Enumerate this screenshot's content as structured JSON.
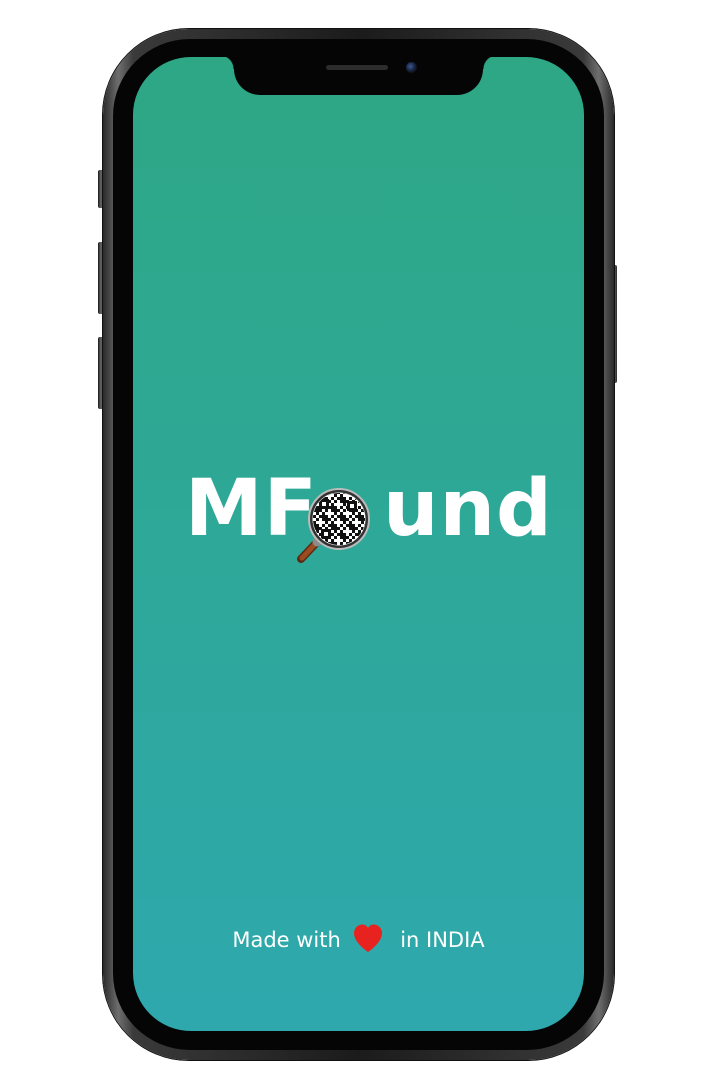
{
  "app": {
    "logo": {
      "text_left": "MF",
      "text_right": "und",
      "magnifier_icon": "magnifying-glass-qr-icon"
    },
    "footer": {
      "prefix": "Made with",
      "heart_icon": "heart-icon",
      "suffix": "in INDIA"
    }
  },
  "colors": {
    "background_top": "#2ea785",
    "background_bottom": "#2ea8ad",
    "heart": "#e8231f",
    "text": "#ffffff"
  }
}
